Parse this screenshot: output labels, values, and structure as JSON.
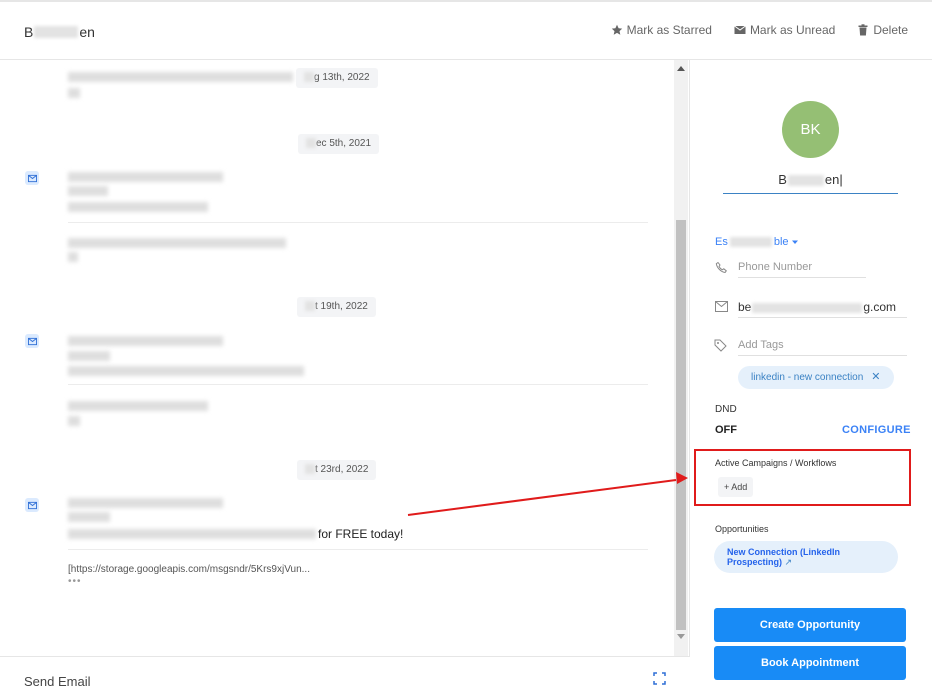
{
  "header": {
    "contact_name_start": "B",
    "contact_name_end": "en",
    "actions": {
      "starred": "Mark as Starred",
      "unread": "Mark as Unread",
      "delete": "Delete"
    }
  },
  "conversation": {
    "dates": [
      "g 13th, 2022",
      "ec 5th, 2021",
      "t 19th, 2022",
      "t 23rd, 2022"
    ],
    "free_text": "for FREE today!",
    "link_text": "[https://storage.googleapis.com/msgsndr/5Krs9xjVun...",
    "more_dots": "•••"
  },
  "footer": {
    "send_email": "Send Email"
  },
  "contact": {
    "avatar_initials": "BK",
    "name_start": "B",
    "name_end": "en",
    "owner_start": "Es",
    "owner_end": "ble",
    "phone_placeholder": "Phone Number",
    "email_start": "be",
    "email_end": "g.com",
    "tags_placeholder": "Add Tags",
    "tags": [
      "linkedin - new connection"
    ],
    "dnd_label": "DND",
    "dnd_value": "OFF",
    "configure_label": "CONFIGURE",
    "campaigns_label": "Active Campaigns / Workflows",
    "add_label": "Add",
    "opportunities_label": "Opportunities",
    "opportunity_line1": "New Connection (LinkedIn",
    "opportunity_line2": "Prospecting)",
    "create_opportunity": "Create Opportunity",
    "book_appointment": "Book Appointment"
  },
  "colors": {
    "accent": "#188bf6",
    "avatar": "#95bf74",
    "highlight": "#e01b1b"
  }
}
